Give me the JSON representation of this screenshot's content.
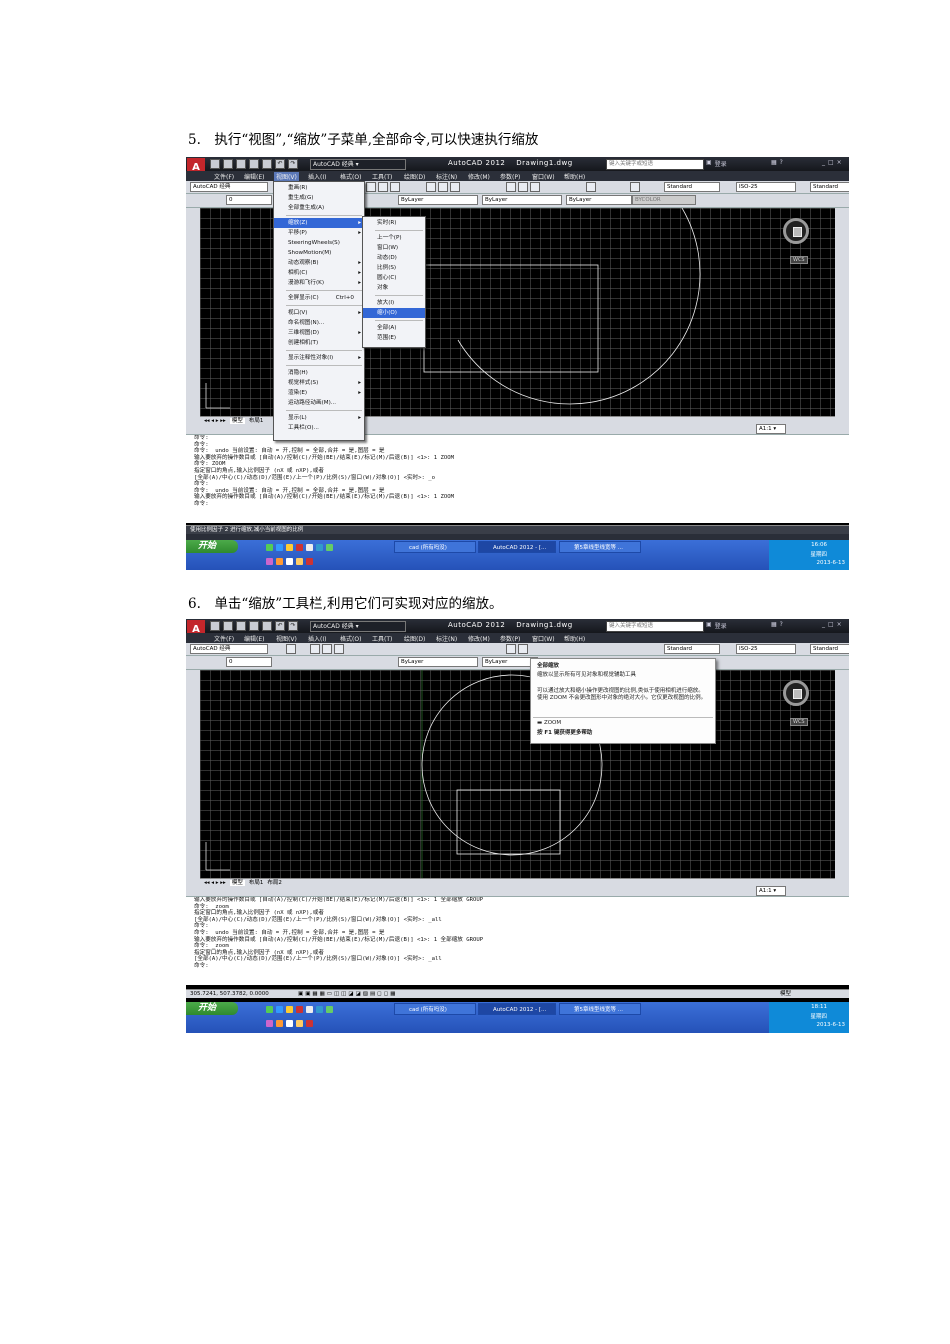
{
  "caption1": "5.　执行“视图”,“缩放”子菜单,全部命令,可以快速执行缩放",
  "caption2": "6.　单击“缩放”工具栏,利用它们可实现对应的缩放。",
  "app": {
    "title": "AutoCAD 2012",
    "drawing": "Drawing1.dwg",
    "workspace": "AutoCAD 经典",
    "search_placeholder": "键入关键字或短语",
    "login": "登录",
    "logo": "A"
  },
  "menubar": [
    "文件(F)",
    "编辑(E)",
    "视图(V)",
    "插入(I)",
    "格式(O)",
    "工具(T)",
    "绘图(D)",
    "标注(N)",
    "修改(M)",
    "参数(P)",
    "窗口(W)",
    "帮助(H)"
  ],
  "toolbar": {
    "workspace_combo": "AutoCAD 经典",
    "textstyle": "Standard",
    "dimstyle": "ISO-25",
    "tablestyle": "Standard",
    "layer": "0",
    "color": "ByLayer",
    "linetype": "ByLayer",
    "lineweight": "ByLayer",
    "plotstyle": "BYCOLOR"
  },
  "view_menu": [
    {
      "label": "重画(R)"
    },
    {
      "label": "重生成(G)"
    },
    {
      "label": "全部重生成(A)"
    },
    {
      "label": "缩放(Z)",
      "sub": true,
      "selected": true
    },
    {
      "label": "平移(P)",
      "sub": true
    },
    {
      "label": "SteeringWheels(S)"
    },
    {
      "label": "ShowMotion(M)"
    },
    {
      "label": "动态观察(B)",
      "sub": true
    },
    {
      "label": "相机(C)",
      "sub": true
    },
    {
      "label": "漫游和飞行(K)",
      "sub": true
    },
    {
      "label": "全屏显示(C)",
      "shortcut": "Ctrl+0"
    },
    {
      "label": "视口(V)",
      "sub": true
    },
    {
      "label": "命名视图(N)..."
    },
    {
      "label": "三维视图(D)",
      "sub": true
    },
    {
      "label": "创建相机(T)"
    },
    {
      "label": "显示注释性对象(I)",
      "sub": true
    },
    {
      "label": "消隐(H)"
    },
    {
      "label": "视觉样式(S)",
      "sub": true
    },
    {
      "label": "渲染(E)",
      "sub": true
    },
    {
      "label": "运动路径动画(M)..."
    },
    {
      "label": "显示(L)",
      "sub": true
    },
    {
      "label": "工具栏(O)..."
    }
  ],
  "zoom_menu": [
    {
      "label": "实时(R)"
    },
    {
      "label": "上一个(P)"
    },
    {
      "label": "窗口(W)"
    },
    {
      "label": "动态(D)"
    },
    {
      "label": "比例(S)"
    },
    {
      "label": "圆心(C)"
    },
    {
      "label": "对象"
    },
    {
      "label": "放大(I)"
    },
    {
      "label": "缩小(O)",
      "selected": true
    },
    {
      "label": "全部(A)"
    },
    {
      "label": "范围(E)"
    }
  ],
  "shot1": {
    "cmd_lines": [
      "命令:",
      "命令:",
      "命令:  undo 当前设置: 自动 = 开,控制 = 全部,合并 = 是,图层 = 是",
      "输入要放弃的操作数目或 [自动(A)/控制(C)/开始(BE)/结束(E)/标记(M)/后退(B)] <1>: 1 ZOOM",
      "命令: ZOOM",
      "指定窗口的角点,输入比例因子 (nX 或 nXP),或者",
      "[全部(A)/中心(C)/动态(D)/范围(E)/上一个(P)/比例(S)/窗口(W)/对象(O)] <实时>: _o",
      "命令:",
      "命令:  undo 当前设置: 自动 = 开,控制 = 全部,合并 = 是,图层 = 是",
      "输入要放弃的操作数目或 [自动(A)/控制(C)/开始(BE)/结束(E)/标记(M)/后退(B)] <1>: 1 ZOOM",
      "命令:"
    ],
    "status": "使用比例因子 2 进行缩放,减小当前视图的比例",
    "time": "16:06",
    "weekday": "星期四",
    "date": "2013-6-13",
    "tabs": [
      "模型",
      "布局1"
    ]
  },
  "shot2": {
    "cmd_lines": [
      "输入要放弃的操作数目或 [自动(A)/控制(C)/开始(BE)/结束(E)/标记(M)/后退(B)] <1>: 1 全部缩放 GROUP",
      "命令: _zoom",
      "指定窗口的角点,输入比例因子 (nX 或 nXP),或者",
      "[全部(A)/中心(C)/动态(D)/范围(E)/上一个(P)/比例(S)/窗口(W)/对象(O)] <实时>: _all",
      "命令:",
      "命令:  undo 当前设置: 自动 = 开,控制 = 全部,合并 = 是,图层 = 是",
      "输入要放弃的操作数目或 [自动(A)/控制(C)/开始(BE)/结束(E)/标记(M)/后退(B)] <1>: 1 全部缩放 GROUP",
      "命令: _zoom",
      "指定窗口的角点,输入比例因子 (nX 或 nXP),或者",
      "[全部(A)/中心(C)/动态(D)/范围(E)/上一个(P)/比例(S)/窗口(W)/对象(O)] <实时>: _all",
      "命令:"
    ],
    "coords": "305.7241, 507.3782, 0.0000",
    "model_label": "模型",
    "time": "18:11",
    "weekday": "星期四",
    "date": "2013-6-13",
    "tabs": [
      "模型",
      "布局1",
      "布局2"
    ],
    "tooltip": {
      "title": "全部缩放",
      "desc": "缩放以显示所有可见对象和视觉辅助工具",
      "detail": "可以通过放大和缩小操作更改视图的比例,类似于使用相机进行缩放。使用 ZOOM 不会更改图形中对象的绝对大小。它仅更改视图的比例。",
      "command": "ZOOM",
      "help": "按 F1 键获得更多帮助"
    }
  },
  "taskbar": {
    "start": "开始",
    "items": [
      "cad (所有吗没)",
      "AutoCAD 2012 - [...",
      "第5章线型线宽等 ..."
    ]
  }
}
